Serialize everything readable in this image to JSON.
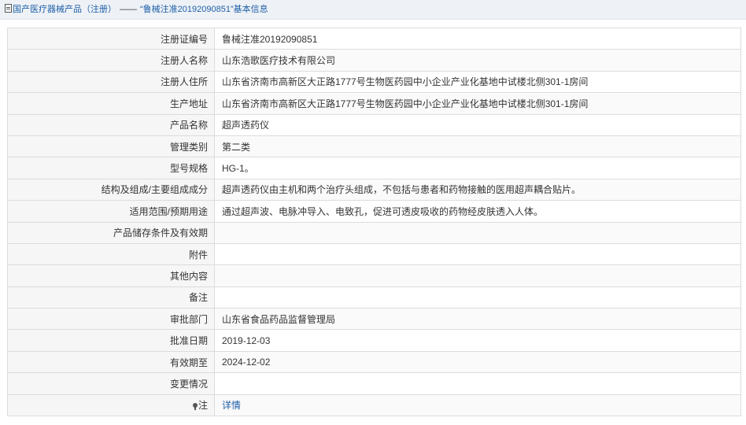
{
  "breadcrumb": {
    "root": "国产医疗器械产品（注册）",
    "separator": "——",
    "current": "“鲁械注准20192090851”基本信息"
  },
  "rows": [
    {
      "label": "注册证编号",
      "value": "鲁械注准20192090851"
    },
    {
      "label": "注册人名称",
      "value": "山东浩歌医疗技术有限公司"
    },
    {
      "label": "注册人住所",
      "value": "山东省济南市高新区大正路1777号生物医药园中小企业产业化基地中试楼北侧301-1房间"
    },
    {
      "label": "生产地址",
      "value": "山东省济南市高新区大正路1777号生物医药园中小企业产业化基地中试楼北侧301-1房间"
    },
    {
      "label": "产品名称",
      "value": "超声透药仪"
    },
    {
      "label": "管理类别",
      "value": "第二类"
    },
    {
      "label": "型号规格",
      "value": "HG-1。"
    },
    {
      "label": "结构及组成/主要组成成分",
      "value": "超声透药仪由主机和两个治疗头组成，不包括与患者和药物接触的医用超声耦合贴片。"
    },
    {
      "label": "适用范围/预期用途",
      "value": "通过超声波、电脉冲导入、电致孔，促进可透皮吸收的药物经皮肤透入人体。"
    },
    {
      "label": "产品储存条件及有效期",
      "value": ""
    },
    {
      "label": "附件",
      "value": ""
    },
    {
      "label": "其他内容",
      "value": ""
    },
    {
      "label": "备注",
      "value": ""
    },
    {
      "label": "审批部门",
      "value": "山东省食品药品监督管理局"
    },
    {
      "label": "批准日期",
      "value": "2019-12-03"
    },
    {
      "label": "有效期至",
      "value": "2024-12-02"
    },
    {
      "label": "变更情况",
      "value": ""
    }
  ],
  "note_row": {
    "label": "注",
    "icon": "pin-icon",
    "link_text": "详情"
  },
  "colors": {
    "link": "#1f5fa8",
    "header_bg": "#eef2f6",
    "label_bg": "#f6f6f6",
    "border": "#dcdcdc"
  }
}
